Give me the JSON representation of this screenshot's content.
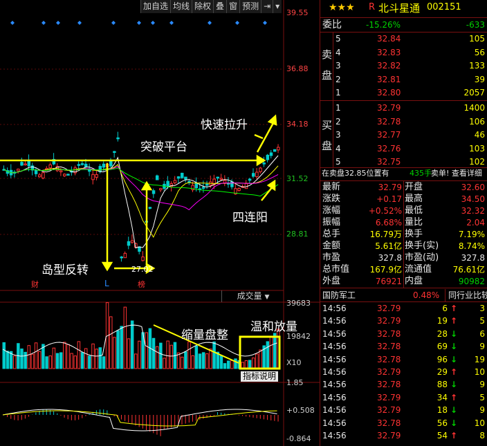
{
  "toolbar": {
    "buttons": [
      "加自选",
      "均线",
      "除权",
      "叠",
      "窗",
      "预测"
    ],
    "icon_right": "exit-icon",
    "icon_menu": "dropdown-icon"
  },
  "chart": {
    "price_labels": [
      "39.55",
      "36.88",
      "34.18",
      "31.52",
      "28.81"
    ],
    "low_label": "27.02",
    "markers": {
      "cai": "财",
      "L": "L",
      "bang": "榜"
    },
    "annotations": {
      "speedup": "快速拉升",
      "breakthrough": "突破平台",
      "four_up": "四连阳",
      "island": "岛型反转",
      "shrink": "缩量盘整",
      "mild": "温和放量"
    },
    "volume_button": "成交量",
    "volume_labels": [
      "39683",
      "19842",
      "X10"
    ],
    "indicator_button": "指标说明",
    "macd_labels": [
      "1.85",
      "+0.508",
      "-0.864"
    ],
    "colors": {
      "up": "#ff3333",
      "down": "#00cccc",
      "ma5": "#ffffff",
      "ma10": "#ffff00",
      "ma20": "#ff00ff",
      "ma60": "#00ff00",
      "arrow": "#ffff00"
    }
  },
  "stock": {
    "stars": "★★★",
    "prefix": "R",
    "name": "北斗星通",
    "code": "002151",
    "weibi_label": "委比",
    "weibi_pct": "-15.26%",
    "weibi_val": "-633",
    "sell_label": [
      "卖",
      "盘"
    ],
    "buy_label": [
      "买",
      "盘"
    ],
    "asks": [
      {
        "lvl": "5",
        "price": "32.84",
        "vol": "105"
      },
      {
        "lvl": "4",
        "price": "32.83",
        "vol": "56"
      },
      {
        "lvl": "3",
        "price": "32.82",
        "vol": "133"
      },
      {
        "lvl": "2",
        "price": "32.81",
        "vol": "39"
      },
      {
        "lvl": "1",
        "price": "32.80",
        "vol": "2057"
      }
    ],
    "bids": [
      {
        "lvl": "1",
        "price": "32.79",
        "vol": "1400"
      },
      {
        "lvl": "2",
        "price": "32.78",
        "vol": "106"
      },
      {
        "lvl": "3",
        "price": "32.77",
        "vol": "46"
      },
      {
        "lvl": "4",
        "price": "32.76",
        "vol": "103"
      },
      {
        "lvl": "5",
        "price": "32.75",
        "vol": "102"
      }
    ],
    "status_left": "在卖盘32.85位置有",
    "status_vol": "435手",
    "status_right": "卖单! 查看详细",
    "quote_left": [
      {
        "k": "最新",
        "v": "32.79"
      },
      {
        "k": "涨跌",
        "v": "+0.17"
      },
      {
        "k": "涨幅",
        "v": "+0.52%"
      },
      {
        "k": "振幅",
        "v": "6.68%"
      },
      {
        "k": "总手",
        "v": "16.79万"
      },
      {
        "k": "金额",
        "v": "5.61亿"
      },
      {
        "k": "市盈",
        "v": "327.8"
      },
      {
        "k": "总市值",
        "v": "167.9亿"
      },
      {
        "k": "外盘",
        "v": "76921"
      }
    ],
    "quote_right": [
      {
        "k": "开盘",
        "v": "32.60"
      },
      {
        "k": "最高",
        "v": "34.50"
      },
      {
        "k": "最低",
        "v": "32.32"
      },
      {
        "k": "量比",
        "v": "2.04"
      },
      {
        "k": "换手",
        "v": "7.19%"
      },
      {
        "k": "换手(实)",
        "v": "8.74%"
      },
      {
        "k": "市盈(动)",
        "v": "327.8"
      },
      {
        "k": "流通值",
        "v": "76.61亿"
      },
      {
        "k": "内盘",
        "v": "90982"
      }
    ],
    "industry": "国防军工",
    "industry_pct": "0.48%",
    "industry_btn": "同行业比较",
    "ticks": [
      {
        "t": "14:56",
        "p": "32.79",
        "v": "6",
        "d": "up",
        "n": "3"
      },
      {
        "t": "14:56",
        "p": "32.79",
        "v": "19",
        "d": "up",
        "n": "5"
      },
      {
        "t": "14:56",
        "p": "32.78",
        "v": "28",
        "d": "down",
        "n": "6"
      },
      {
        "t": "14:56",
        "p": "32.78",
        "v": "69",
        "d": "down",
        "n": "9"
      },
      {
        "t": "14:56",
        "p": "32.78",
        "v": "96",
        "d": "down",
        "n": "19"
      },
      {
        "t": "14:56",
        "p": "32.79",
        "v": "29",
        "d": "up",
        "n": "10"
      },
      {
        "t": "14:56",
        "p": "32.78",
        "v": "88",
        "d": "down",
        "n": "9"
      },
      {
        "t": "14:56",
        "p": "32.79",
        "v": "34",
        "d": "up",
        "n": "5"
      },
      {
        "t": "14:56",
        "p": "32.79",
        "v": "18",
        "d": "down",
        "n": "9"
      },
      {
        "t": "14:56",
        "p": "32.78",
        "v": "56",
        "d": "down",
        "n": "10"
      },
      {
        "t": "14:56",
        "p": "32.79",
        "v": "54",
        "d": "up",
        "n": "8"
      }
    ]
  }
}
